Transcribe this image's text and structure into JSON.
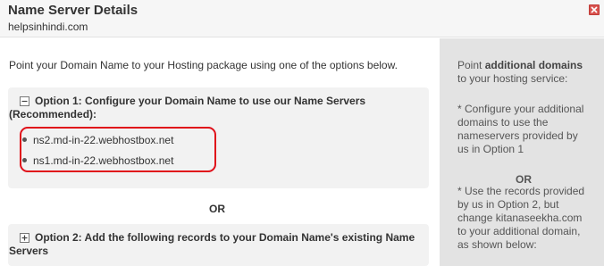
{
  "header": {
    "title": "Name Server Details",
    "subtitle": "helpsinhindi.com",
    "close_icon": "close-icon",
    "close_color": "#d9534f"
  },
  "main": {
    "intro": "Point your Domain Name to your Hosting package using one of the options below.",
    "option1": {
      "toggle_icon": "collapse-minus-icon",
      "title": "Option 1: Configure your Domain Name to use our Name Servers",
      "title_line2": "(Recommended):",
      "nameservers": [
        "ns2.md-in-22.webhostbox.net",
        "ns1.md-in-22.webhostbox.net"
      ]
    },
    "or_label": "OR",
    "option2": {
      "toggle_icon": "expand-plus-icon",
      "title": "Option 2: Add the following records to your Domain Name's existing Name",
      "title_line2": "Servers"
    }
  },
  "sidebar": {
    "point_prefix": "Point ",
    "point_bold": "additional domains",
    "point_suffix": "to your hosting service:",
    "item1_lines": [
      "* Configure your additional",
      "domains to use the",
      "nameservers provided by",
      "us in Option 1"
    ],
    "or_label": "OR",
    "item2_lines": [
      "* Use the records provided",
      "by us in Option 2, but",
      "change kitanaseekha.com",
      "to your additional domain,",
      "as shown below:"
    ]
  },
  "colors": {
    "highlight_border": "#e0101a",
    "sidebar_bg": "#e3e3e3",
    "option_bg": "#f2f2f2"
  }
}
